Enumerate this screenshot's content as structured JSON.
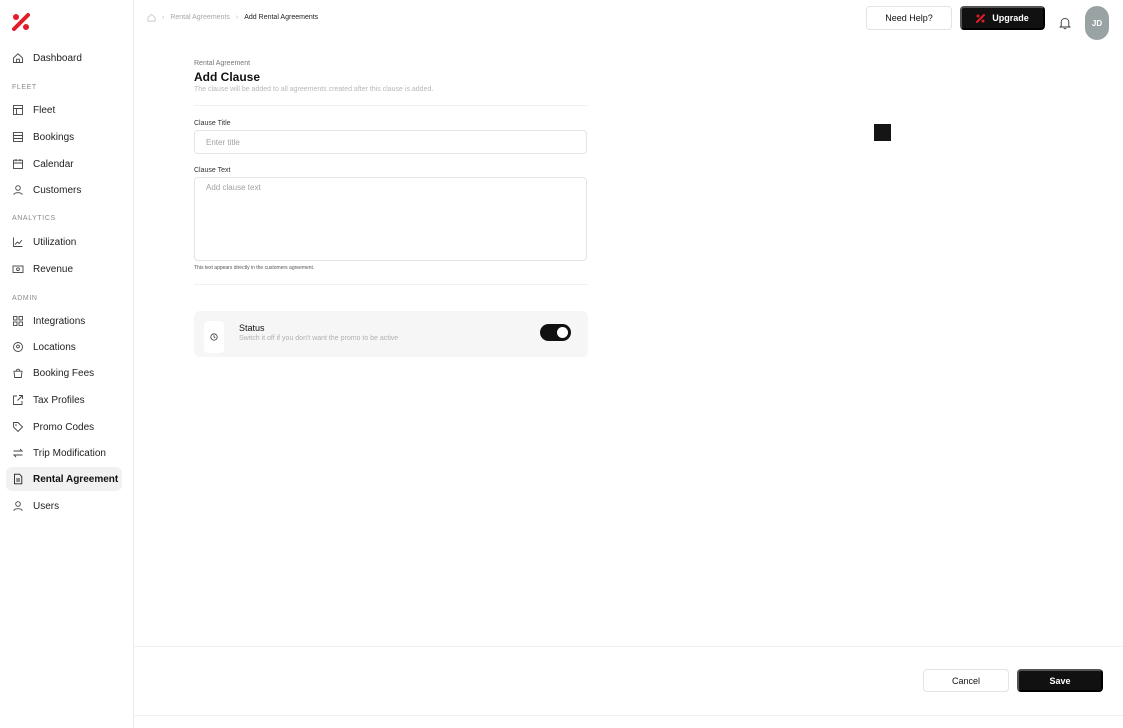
{
  "brand": {
    "accent": "#e11d2a"
  },
  "sidebar": {
    "items": [
      {
        "label": "Dashboard",
        "icon": "home-icon"
      },
      {
        "section": "FLEET"
      },
      {
        "label": "Fleet",
        "icon": "layout-icon"
      },
      {
        "label": "Bookings",
        "icon": "inbox-icon"
      },
      {
        "label": "Calendar",
        "icon": "calendar-icon"
      },
      {
        "label": "Customers",
        "icon": "user-icon"
      },
      {
        "section": "ANALYTICS"
      },
      {
        "label": "Utilization",
        "icon": "chart-line-icon"
      },
      {
        "label": "Revenue",
        "icon": "banknote-icon"
      },
      {
        "section": "ADMIN"
      },
      {
        "label": "Integrations",
        "icon": "grid-icon"
      },
      {
        "label": "Locations",
        "icon": "map-pin-icon"
      },
      {
        "label": "Booking Fees",
        "icon": "shopping-bag-icon"
      },
      {
        "label": "Tax Profiles",
        "icon": "external-link-icon"
      },
      {
        "label": "Promo Codes",
        "icon": "tag-icon"
      },
      {
        "label": "Trip Modification",
        "icon": "swap-icon"
      },
      {
        "label": "Rental Agreement",
        "icon": "file-text-icon",
        "active": true
      },
      {
        "label": "Users",
        "icon": "user-icon"
      }
    ]
  },
  "header": {
    "breadcrumb": [
      "Rental Agreements",
      "Add Rental Agreements"
    ],
    "help_label": "Need Help?",
    "upgrade_label": "Upgrade",
    "avatar_initials": "JD"
  },
  "form": {
    "eyebrow": "Rental Agreement",
    "title": "Add Clause",
    "subtitle": "The clause will be added to all agreements created after this clause is added.",
    "clause_title_label": "Clause Title",
    "clause_title_placeholder": "Enter title",
    "clause_title_value": "",
    "clause_text_label": "Clause Text",
    "clause_text_placeholder": "Add clause text",
    "clause_text_value": "",
    "clause_text_hint": "This text appears directly in the customers agreement.",
    "status_title": "Status",
    "status_desc": "Switch it off if you don't want the promo to be active",
    "status_on": true
  },
  "footer": {
    "cancel_label": "Cancel",
    "save_label": "Save"
  }
}
